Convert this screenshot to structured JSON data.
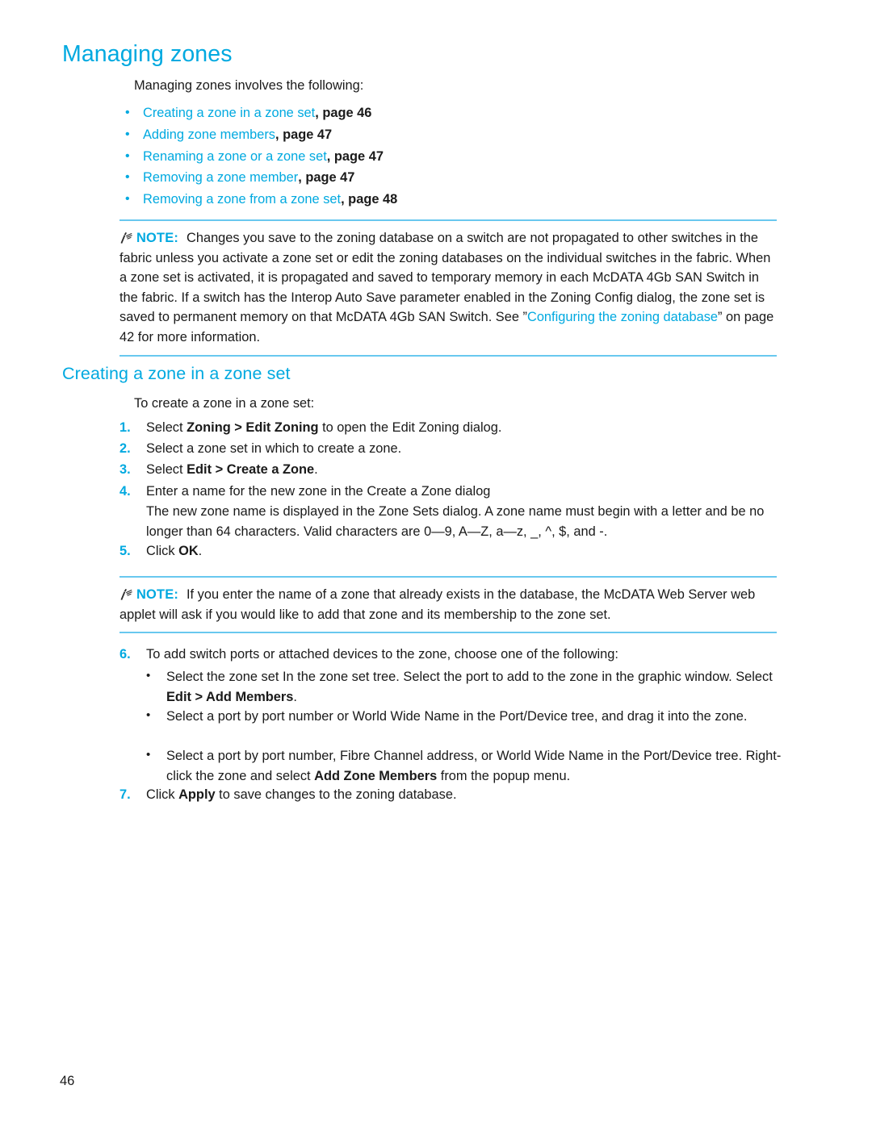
{
  "document": {
    "page_number": "46"
  },
  "colors": {
    "heading": "#00a9e0",
    "rule": "#69c8ef",
    "body": "#1a1a1a"
  },
  "section_managing_zones": {
    "heading": "Managing zones",
    "intro": "Managing zones involves the following:",
    "toc": [
      {
        "title": "Creating a zone in a zone set",
        "page": ", page 46"
      },
      {
        "title": "Adding zone members",
        "page": ", page 47"
      },
      {
        "title": "Renaming a zone or a zone set",
        "page": ", page 47"
      },
      {
        "title": "Removing a zone member",
        "page": ", page 47"
      },
      {
        "title": "Removing a zone from a zone set",
        "page": ", page 48"
      }
    ]
  },
  "note_1": {
    "label": "NOTE:",
    "icon": "note-pencil-icon",
    "text_part_1": "Changes you save to the zoning database on a switch are not propagated to other switches in the fabric unless you activate a zone set or edit the zoning databases on the individual switches in the fabric. When a zone set is activated, it is propagated and saved to temporary memory in each McDATA 4Gb SAN Switch in the fabric. If a switch has the Interop Auto Save parameter enabled in the Zoning Config dialog, the zone set is saved to permanent memory on that McDATA 4Gb SAN Switch. See ”",
    "link_text": "Configuring the zoning database",
    "text_part_2": "” on page 42 for more information."
  },
  "section_creating_zone": {
    "heading": "Creating a zone in a zone set",
    "intro": "To create a zone in a zone set:",
    "steps": [
      {
        "num": "1.",
        "pre": "Select ",
        "bold": "Zoning > Edit Zoning",
        "post": " to open the Edit Zoning dialog."
      },
      {
        "num": "2.",
        "pre": "Select a zone set in which to create a zone.",
        "bold": "",
        "post": ""
      },
      {
        "num": "3.",
        "pre": "Select ",
        "bold": "Edit > Create a Zone",
        "post": "."
      },
      {
        "num": "4.",
        "pre": "Enter a name for the new zone in the Create a Zone dialog",
        "bold": "",
        "post": ""
      },
      {
        "num": "5.",
        "pre": "Click ",
        "bold": "OK",
        "post": "."
      }
    ],
    "step4_paragraph": "The new zone name is displayed in the Zone Sets dialog. A zone name must begin with a letter and be no longer than 64 characters. Valid characters are 0—9, A—Z, a—z, _, ^, $, and -."
  },
  "note_2": {
    "label": "NOTE:",
    "icon": "note-pencil-icon",
    "text": "If you enter the name of a zone that already exists in the database, the McDATA Web Server web applet will ask if you would like to add that zone and its membership to the zone set."
  },
  "section_add_members": {
    "step6": {
      "num": "6.",
      "text": "To add switch ports or attached devices to the zone, choose one of the following:"
    },
    "bullets": [
      {
        "pre": "Select the zone set In the zone set tree. Select the port to add to the zone in the graphic window. Select ",
        "bold": "Edit > Add Members",
        "post": "."
      },
      {
        "pre": "Select a port by port number or World Wide Name in the Port/Device tree, and drag it into the zone.",
        "bold": "",
        "post": ""
      },
      {
        "pre": "Select a port by port number, Fibre Channel address, or World Wide Name in the Port/Device tree. Right-click the zone and select ",
        "bold": "Add Zone Members",
        "post": " from the popup menu."
      }
    ],
    "step7": {
      "num": "7.",
      "pre": "Click ",
      "bold": "Apply",
      "post": " to save changes to the zoning database."
    }
  }
}
